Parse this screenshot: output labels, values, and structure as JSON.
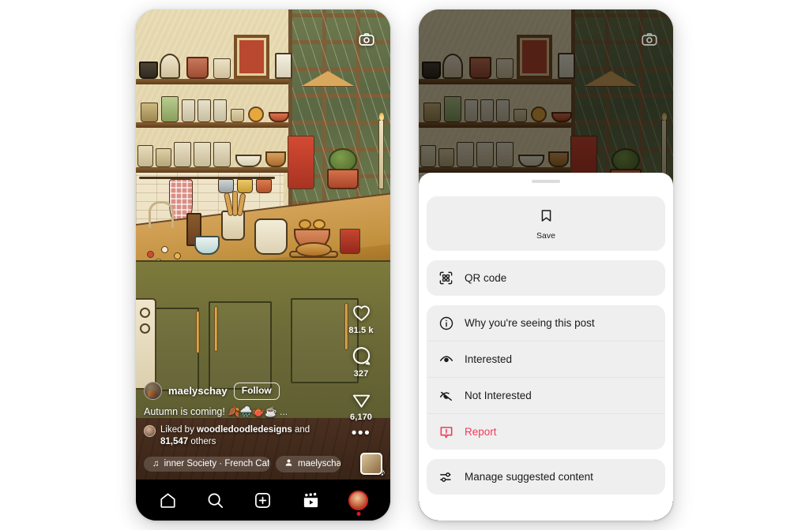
{
  "app": "instagram-reel",
  "left_phone": {
    "camera_icon": "camera-icon",
    "post": {
      "username": "maelyschay",
      "follow_label": "Follow",
      "caption": "Autumn is coming! 🍂🌧️🫖☕",
      "caption_more": "...",
      "liked_by_prefix": "Liked by",
      "liked_by_user": "woodledoodledesigns",
      "liked_by_mid": "and",
      "liked_by_count": "81,547",
      "liked_by_suffix": "others"
    },
    "actions": [
      {
        "icon": "heart-icon",
        "name": "like-button",
        "count": "81.5 k"
      },
      {
        "icon": "comment-icon",
        "name": "comment-button",
        "count": "327"
      },
      {
        "icon": "share-icon",
        "name": "share-button",
        "count": "6,170"
      },
      {
        "icon": "more-icon",
        "name": "more-options-button",
        "count": ""
      }
    ],
    "pills": {
      "music_icon": "music-note-icon",
      "music_label": "inner Society · French Cafe",
      "tag_icon": "person-icon",
      "tag_label": "maelyscha",
      "audio_thumb": "audio-thumbnail"
    },
    "nav": [
      {
        "name": "nav-home",
        "icon": "home-icon"
      },
      {
        "name": "nav-search",
        "icon": "search-icon"
      },
      {
        "name": "nav-create",
        "icon": "plus-square-icon"
      },
      {
        "name": "nav-reels",
        "icon": "reels-icon"
      },
      {
        "name": "nav-profile",
        "icon": "profile-avatar-icon"
      }
    ]
  },
  "right_phone": {
    "camera_icon": "camera-icon",
    "sheet": {
      "grabber": "sheet-grabber",
      "save": {
        "icon": "bookmark-icon",
        "label": "Save"
      },
      "group_a": [
        {
          "icon": "qr-code-icon",
          "label": "QR code",
          "name": "menu-qr-code"
        }
      ],
      "group_b": [
        {
          "icon": "info-circle-icon",
          "label": "Why you're seeing this post",
          "name": "menu-why-seeing",
          "danger": false
        },
        {
          "icon": "eye-icon",
          "label": "Interested",
          "name": "menu-interested",
          "danger": false
        },
        {
          "icon": "eye-off-icon",
          "label": "Not Interested",
          "name": "menu-not-interested",
          "danger": false
        },
        {
          "icon": "report-icon",
          "label": "Report",
          "name": "menu-report",
          "danger": true
        }
      ],
      "group_c": [
        {
          "icon": "sliders-icon",
          "label": "Manage suggested content",
          "name": "menu-manage-suggested"
        }
      ]
    }
  },
  "colors": {
    "page_bg": "#ffffff",
    "sheet_bg": "#ffffff",
    "card_bg": "#efefef",
    "text": "#1a1a1a",
    "danger": "#ef3c5c",
    "nav_bg": "#000000"
  }
}
